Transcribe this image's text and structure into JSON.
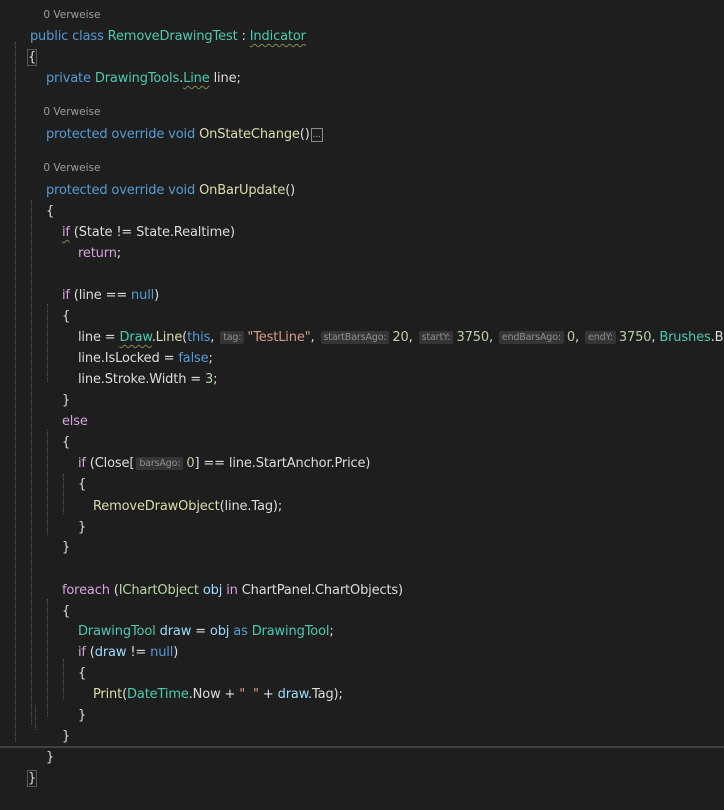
{
  "colors": {
    "background": "#1e1e1e",
    "keyword": "#569cd6",
    "control": "#d8a0df",
    "type": "#4ec9b0",
    "method": "#dcdcaa",
    "string": "#d69d85",
    "number": "#b5cea8",
    "plain": "#dcdcdc",
    "local": "#9cdcfe",
    "lens": "#9d9d9d"
  },
  "codelens": {
    "top_partial": "0 Verweise",
    "on_state_change": "0 Verweise",
    "on_bar_update": "0 Verweise"
  },
  "code": {
    "class_decl": {
      "public": "public",
      "class": "class",
      "name": "RemoveDrawingTest",
      "colon": " : ",
      "base": "Indicator"
    },
    "open_brace_class": "{",
    "field": {
      "private": "private",
      "type_ns": "DrawingTools",
      "dot": ".",
      "type": "Line",
      "name": " line;"
    },
    "on_state_change": {
      "mods": "protected override void",
      "name": "OnStateChange",
      "parens": "()",
      "collapsed": "..."
    },
    "on_bar_update": {
      "mods": "protected override void",
      "name": "OnBarUpdate",
      "parens": "()"
    },
    "open_brace_method": "{",
    "if_state": {
      "kw": "if",
      "rest": " (State != State.Realtime)"
    },
    "return_stmt": {
      "kw": "return",
      "semi": ";"
    },
    "if_line_null": {
      "kw": "if",
      "pre": " (line == ",
      "null": "null",
      "post": ")"
    },
    "brace_1_open": "{",
    "draw_line": {
      "lhs": "line = ",
      "draw": "Draw",
      "dot": ".",
      "method": "Line",
      "open": "(",
      "this": "this",
      "comma1": ", ",
      "hint_tag": "tag:",
      "tag_value": "\"TestLine\"",
      "comma2": ", ",
      "hint_start_bars_ago": "startBarsAgo:",
      "start_bars_ago": "20",
      "comma3": ", ",
      "hint_start_y": "startY:",
      "start_y": "3750",
      "comma4": ", ",
      "hint_end_bars_ago": "endBarsAgo:",
      "end_bars_ago": "0",
      "comma5": ", ",
      "hint_end_y": "endY:",
      "end_y": "3750",
      "comma6": ", ",
      "brushes": "Brushes",
      "blue": ".Blue);"
    },
    "is_locked": {
      "lhs": "line.IsLocked = ",
      "false": "false",
      "semi": ";"
    },
    "stroke_width": {
      "lhs": "line.Stroke.Width = ",
      "value": "3",
      "semi": ";"
    },
    "brace_1_close": "}",
    "else_kw": "else",
    "brace_2_open": "{",
    "if_close": {
      "kw": "if",
      "pre": " (Close[",
      "hint_bars_ago": "barsAgo:",
      "index": "0",
      "post": "] == line.StartAnchor.Price)"
    },
    "brace_3_open": "{",
    "remove_call": {
      "method": "RemoveDrawObject",
      "args": "(line.Tag);"
    },
    "brace_3_close": "}",
    "brace_2_close": "}",
    "foreach_stmt": {
      "kw": "foreach",
      "open": " (",
      "type": "IChartObject",
      "var": " obj ",
      "in": "in",
      "rest": " ChartPanel.ChartObjects)"
    },
    "brace_4_open": "{",
    "drawing_tool_decl": {
      "type": "DrawingTool",
      "var": " draw",
      "eq": " = ",
      "obj": "obj",
      "as": " as ",
      "type2": "DrawingTool",
      "semi": ";"
    },
    "if_draw": {
      "kw": "if",
      "pre": " (",
      "var": "draw",
      "mid": " != ",
      "null": "null",
      "post": ")"
    },
    "brace_5_open": "{",
    "print_stmt": {
      "method": "Print",
      "open": "(",
      "type": "DateTime",
      "rest1": ".Now + ",
      "str": "\"  \"",
      "rest2": " + ",
      "var": "draw",
      "rest3": ".Tag);"
    },
    "brace_5_close": "}",
    "brace_4_close": "}",
    "brace_method_close": "}",
    "brace_class_close": "}"
  }
}
